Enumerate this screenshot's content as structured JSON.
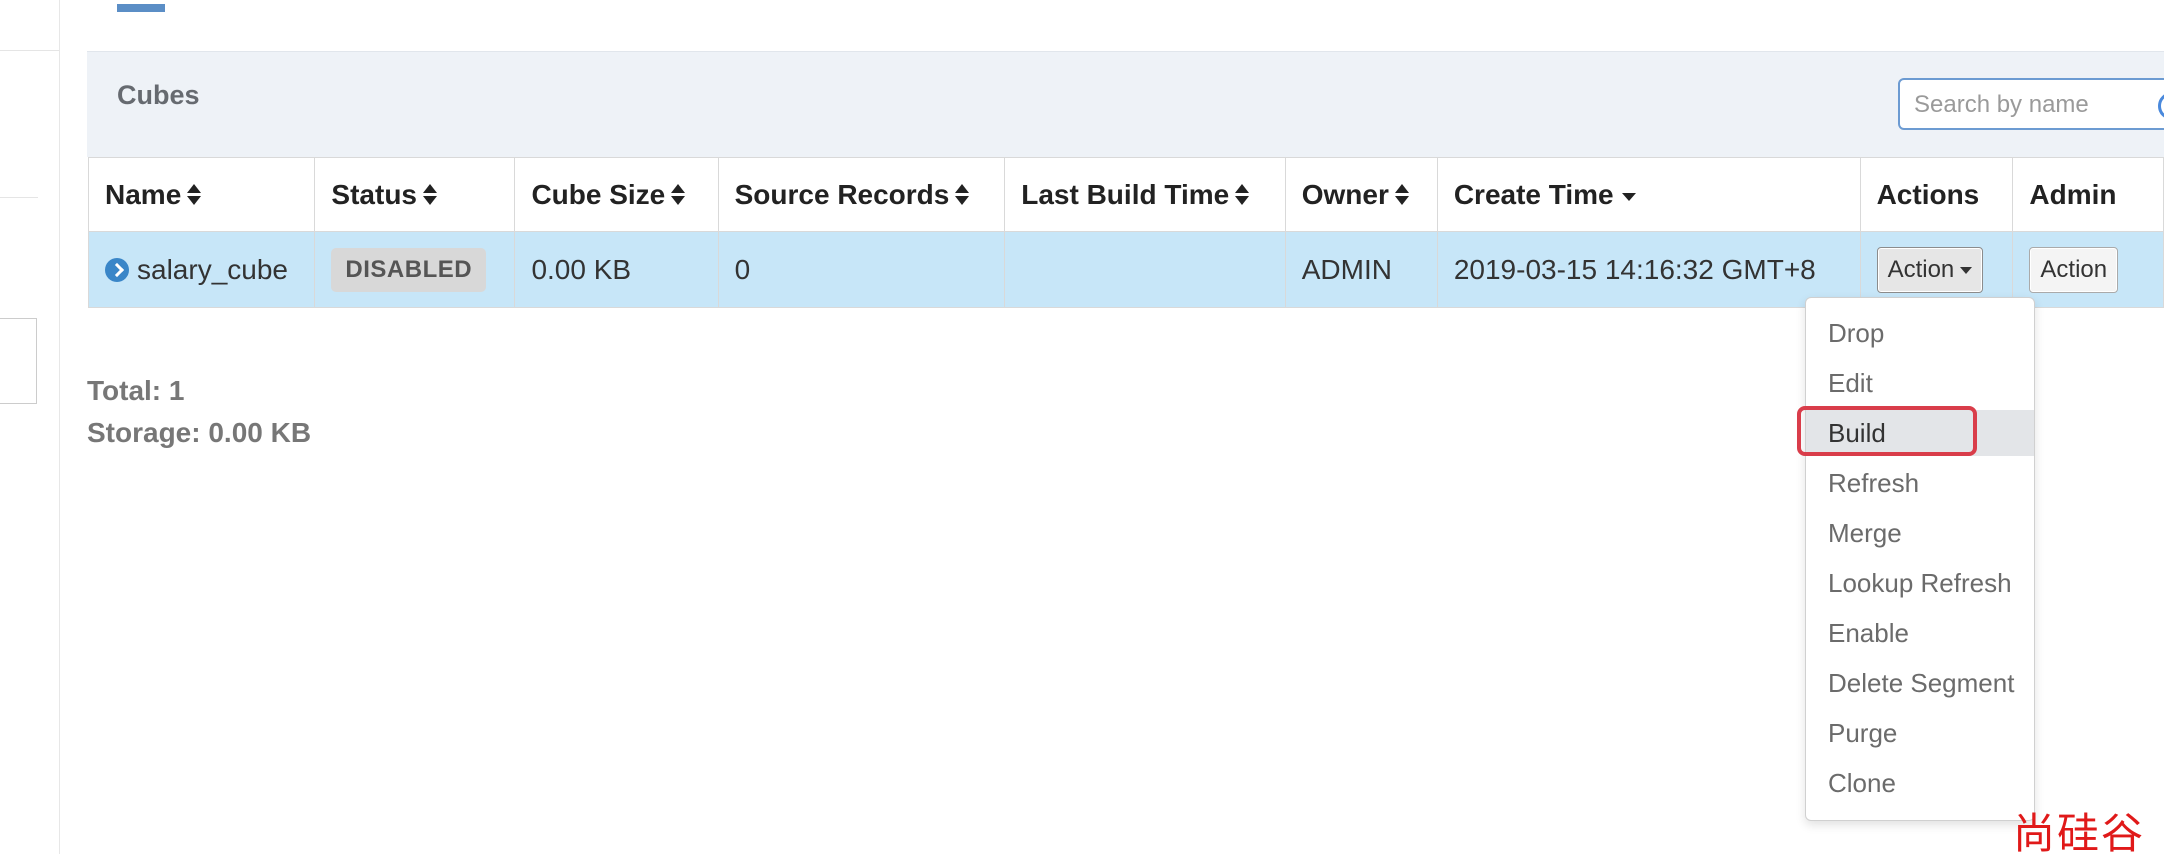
{
  "panel": {
    "title": "Cubes",
    "search_placeholder": "Search by name"
  },
  "table": {
    "columns": [
      {
        "label": "Name",
        "sort": "both"
      },
      {
        "label": "Status",
        "sort": "both"
      },
      {
        "label": "Cube Size",
        "sort": "both"
      },
      {
        "label": "Source Records",
        "sort": "both"
      },
      {
        "label": "Last Build Time",
        "sort": "both"
      },
      {
        "label": "Owner",
        "sort": "both"
      },
      {
        "label": "Create Time",
        "sort": "desc"
      },
      {
        "label": "Actions",
        "sort": "none"
      },
      {
        "label": "Admin",
        "sort": "none"
      }
    ],
    "rows": [
      {
        "name": "salary_cube",
        "status": "DISABLED",
        "cube_size": "0.00 KB",
        "source_records": "0",
        "last_build_time": "",
        "owner": "ADMIN",
        "create_time": "2019-03-15 14:16:32 GMT+8",
        "action_label": "Action",
        "admin_action_label": "Action"
      }
    ]
  },
  "summary": {
    "total": "Total: 1",
    "storage": "Storage: 0.00 KB"
  },
  "action_menu": {
    "items": [
      "Drop",
      "Edit",
      "Build",
      "Refresh",
      "Merge",
      "Lookup Refresh",
      "Enable",
      "Delete Segment",
      "Purge",
      "Clone"
    ],
    "highlighted": "Build"
  },
  "colors": {
    "selected_row": "#c7e6f8",
    "panel_header": "#eef2f7",
    "highlight_border": "#d93d4a",
    "accent": "#5b8ec6"
  },
  "watermark": "尚硅谷"
}
